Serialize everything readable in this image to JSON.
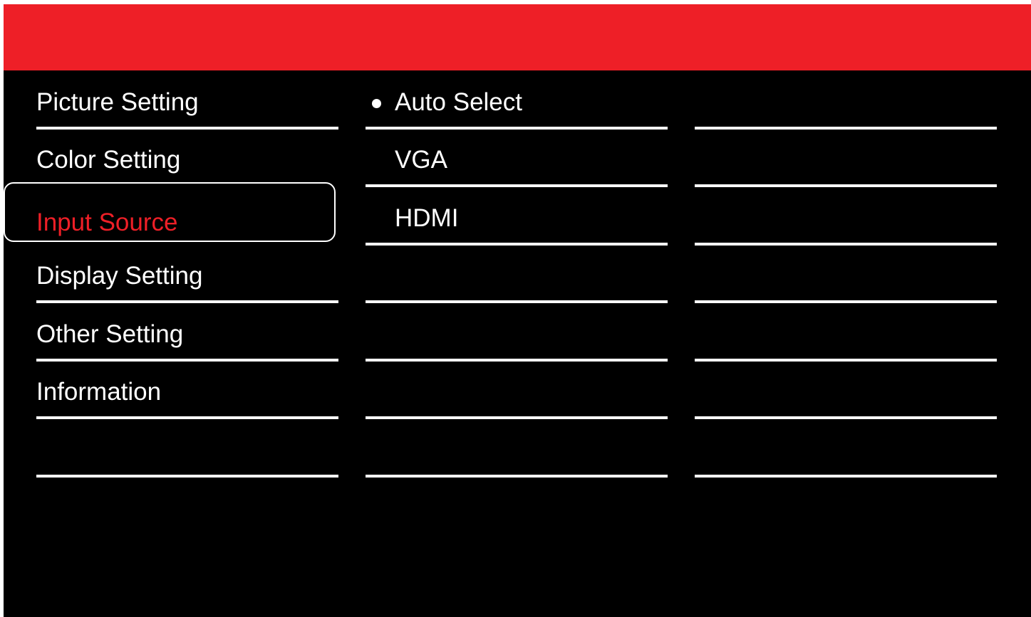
{
  "colors": {
    "header": "#ee1f27",
    "background": "#000000",
    "text": "#ffffff",
    "selected_text": "#ee1f27"
  },
  "main_menu": {
    "items": [
      {
        "label": "Picture Setting"
      },
      {
        "label": "Color Setting"
      },
      {
        "label": "Input Source"
      },
      {
        "label": "Display Setting"
      },
      {
        "label": "Other Setting"
      },
      {
        "label": "Information"
      }
    ],
    "selected_index": 2
  },
  "submenu": {
    "items": [
      {
        "label": "Auto Select",
        "active_icon": "bullet-icon"
      },
      {
        "label": "VGA"
      },
      {
        "label": "HDMI"
      }
    ]
  }
}
